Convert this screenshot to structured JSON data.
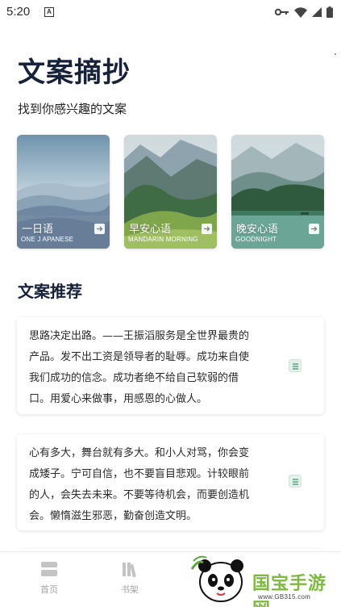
{
  "status_bar": {
    "time": "5:20",
    "a_icon": "A"
  },
  "header": {
    "title": "文案摘抄",
    "subtitle": "找到你感兴趣的文案"
  },
  "categories": [
    {
      "title": "一日语",
      "subtitle": "ONE J APANESE"
    },
    {
      "title": "早安心语",
      "subtitle": "MANDARIN MORNING"
    },
    {
      "title": "晚安心语",
      "subtitle": "GOODNIGHT"
    }
  ],
  "section": {
    "title": "文案推荐"
  },
  "quotes": [
    {
      "lines": [
        "思路决定出路。——王振滔服务是全世界最贵的",
        "产品。发不出工资是领导者的耻辱。成功来自使",
        "我们成功的信念。成功者绝不给自己软弱的借",
        "口。用爱心来做事，用感恩的心做人。"
      ]
    },
    {
      "lines": [
        "心有多大，舞台就有多大。和小人对骂，你会变",
        "成矮子。宁可自信，也不要盲目悲观。计较眼前",
        "的人，会失去未来。不要等待机会，而要创造机",
        "会。懒惰滋生邪恶，勤奋创造文明。"
      ]
    }
  ],
  "tabs": [
    {
      "label": "首页",
      "icon": "home-icon"
    },
    {
      "label": "书架",
      "icon": "bookshelf-icon"
    }
  ],
  "watermark": {
    "brand": "国宝手游网",
    "url": "www.GB315.com"
  },
  "colors": {
    "title": "#17213a",
    "accent": "#7bb89a",
    "tab_inactive": "#a5a5a5"
  }
}
